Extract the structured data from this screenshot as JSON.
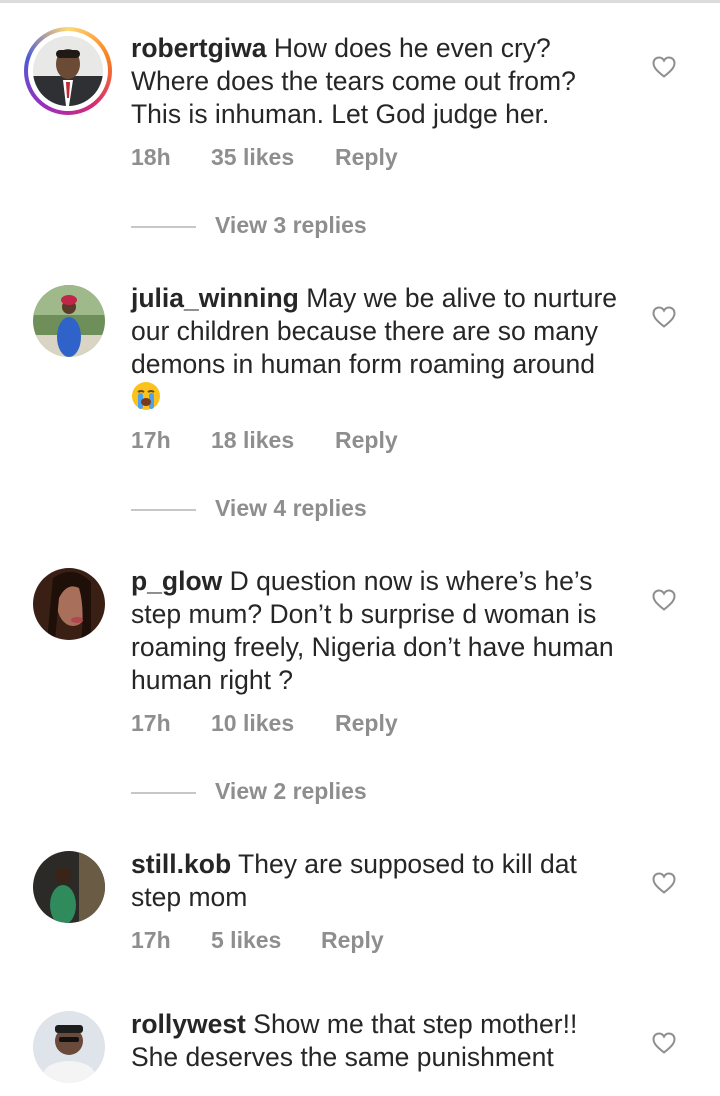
{
  "comments": [
    {
      "username": "robertgiwa",
      "text": "How does he even cry? Where does the tears come out from? This is inhuman. Let God judge her.",
      "time": "18h",
      "likes": "35 likes",
      "reply": "Reply",
      "view_replies": "View 3 replies",
      "story_ring": true
    },
    {
      "username": "julia_winning",
      "text": "May we be alive to nurture our children because there are so many demons in human form roaming around",
      "emoji": "crying-face",
      "time": "17h",
      "likes": "18 likes",
      "reply": "Reply",
      "view_replies": "View 4 replies"
    },
    {
      "username": "p_glow",
      "text": "D question now is where’s he’s step mum? Don’t b surprise d woman is roaming freely, Nigeria don’t have human human right ?",
      "time": "17h",
      "likes": "10 likes",
      "reply": "Reply",
      "view_replies": "View 2 replies"
    },
    {
      "username": "still.kob",
      "text": "They are supposed to kill dat step mom",
      "time": "17h",
      "likes": "5 likes",
      "reply": "Reply"
    },
    {
      "username": "rollywest",
      "text": "Show me that step mother!! She deserves the same punishment"
    }
  ],
  "icons": {
    "like": "heart-outline-icon",
    "emoji": "loudly-crying-face-emoji"
  },
  "colors": {
    "text": "#262626",
    "secondary": "#8e8e8e",
    "divider": "#c7c7c7"
  }
}
